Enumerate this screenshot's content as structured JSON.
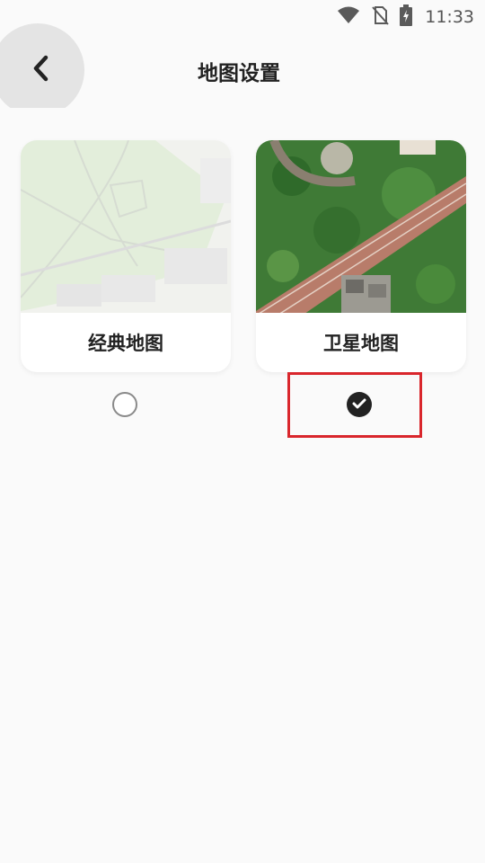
{
  "status": {
    "time": "11:33"
  },
  "header": {
    "title": "地图设置"
  },
  "map_options": [
    {
      "label": "经典地图",
      "selected": false
    },
    {
      "label": "卫星地图",
      "selected": true
    }
  ],
  "colors": {
    "background": "#fafafa",
    "selection_highlight": "#d9262c",
    "selected_check": "#222222"
  },
  "icons": {
    "status": [
      "wifi-icon",
      "no-sim-icon",
      "battery-charging-icon"
    ],
    "back": "chevron-left-icon",
    "selected": "check-icon"
  }
}
